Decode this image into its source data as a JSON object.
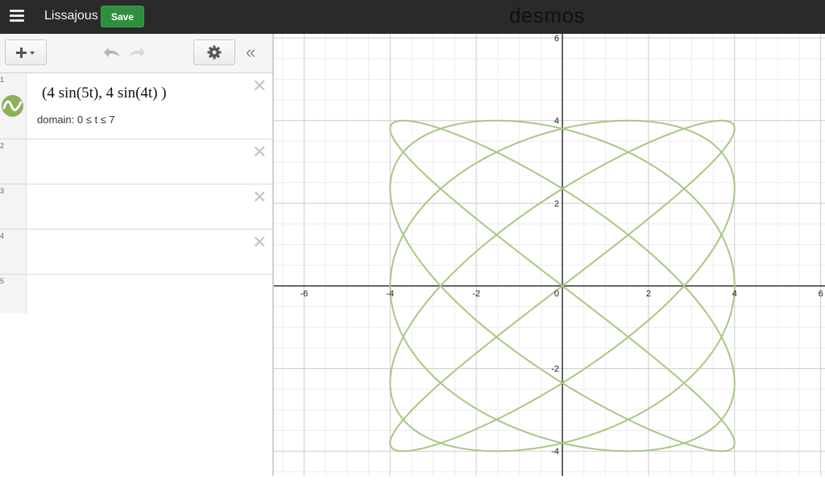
{
  "header": {
    "menu_icon": "hamburger-icon",
    "title": "Lissajous",
    "save_label": "Save",
    "brand": "desmos"
  },
  "toolbar": {
    "add_icon": "plus-icon",
    "undo_icon": "undo-icon",
    "redo_icon": "redo-icon",
    "settings_icon": "gear-icon",
    "collapse_icon": "double-chevron-left-icon"
  },
  "expressions": [
    {
      "number": "1",
      "latex": "(4 sin(5t), 4 sin(4t) )",
      "domain": "domain: 0 ≤ t ≤ 7",
      "color": "#8ab15a"
    },
    {
      "number": "2"
    },
    {
      "number": "3"
    },
    {
      "number": "4"
    },
    {
      "number": "5"
    }
  ],
  "graph": {
    "x_range": [
      -6.7,
      6.1
    ],
    "y_range": [
      -4.6,
      6.1
    ],
    "x_tick_labels": [
      "-6",
      "-4",
      "-2",
      "0",
      "2",
      "4",
      "6"
    ],
    "y_tick_labels": [
      "6",
      "4",
      "2",
      "-2",
      "-4"
    ],
    "curve": {
      "x_expr": "4 sin(5t)",
      "y_expr": "4 sin(4t)",
      "t_range": [
        0,
        7
      ],
      "color": "#a9c784"
    },
    "grid": true
  }
}
